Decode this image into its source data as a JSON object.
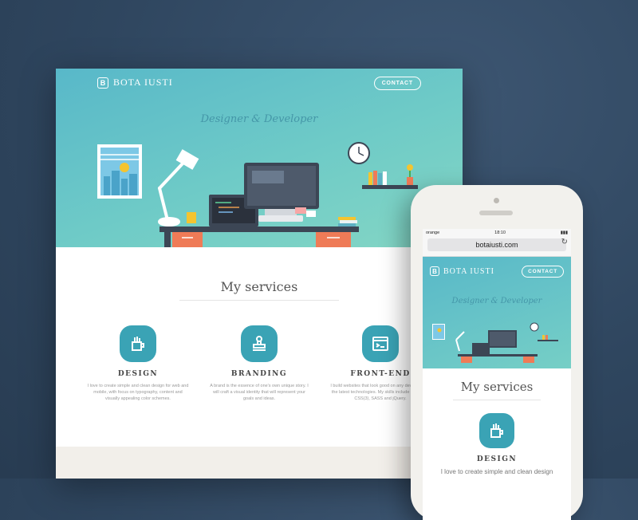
{
  "site": {
    "brand": "BOTA IUSTI",
    "logo_letter": "B",
    "contact_label": "CONTACT",
    "tagline": "Designer & Developer",
    "services_title": "My services"
  },
  "services": [
    {
      "name": "DESIGN",
      "icon": "pencil-cup-icon",
      "desc": "I love to create simple and clean design for web and mobile, with focus on typography, content and visually appealing color schemes."
    },
    {
      "name": "BRANDING",
      "icon": "stamp-icon",
      "desc": "A brand is the essence of one's own unique story. I will craft a visual identity that will represent your goals and ideas."
    },
    {
      "name": "FRONT-END",
      "icon": "code-window-icon",
      "desc": "I build websites that look good on any device, using the latest technologies. My skills include HTML(5), CSS(3), SASS and jQuery."
    }
  ],
  "phone": {
    "carrier": "orange",
    "time": "18:10",
    "url": "botaiusti.com",
    "service_name": "DESIGN",
    "service_desc": "I love to create simple and clean design"
  },
  "colors": {
    "accent": "#3aa3b5",
    "hero_start": "#58b8c9",
    "hero_end": "#84d6c4",
    "background": "#2f465f"
  }
}
